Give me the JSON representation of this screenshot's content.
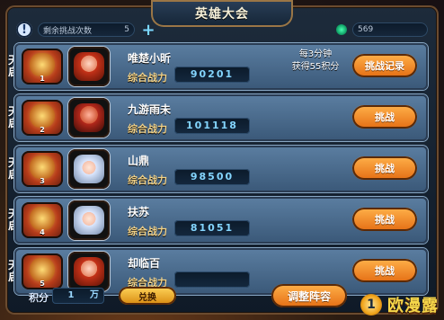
{
  "window": {
    "title": "英雄大会"
  },
  "topbar": {
    "remaining_label": "剩余挑战次数",
    "remaining_value": "5",
    "plus_symbol": "+",
    "coins_value": "569"
  },
  "rows": [
    {
      "rank_tab": [
        "天",
        "启"
      ],
      "badge_rank": "1",
      "name": "唯楚小昕",
      "power_label": "综合战力",
      "power_value": "90201",
      "reward_line1": "每3分钟",
      "reward_line2": "获得55积分",
      "button_label": "挑战记录",
      "avatar_icon": "hero-red-hair-icon",
      "avatar_color": "#c63218"
    },
    {
      "rank_tab": [
        "天",
        "启"
      ],
      "badge_rank": "2",
      "name": "九游雨未",
      "power_label": "综合战力",
      "power_value": "101118",
      "button_label": "挑战",
      "avatar_icon": "hero-red-mask-icon",
      "avatar_color": "#b4281b"
    },
    {
      "rank_tab": [
        "天",
        "启"
      ],
      "badge_rank": "3",
      "name": "山鼎",
      "power_label": "综合战力",
      "power_value": "98500",
      "button_label": "挑战",
      "avatar_icon": "hero-white-hair-icon",
      "avatar_color": "#8fa7c6"
    },
    {
      "rank_tab": [
        "天",
        "启"
      ],
      "badge_rank": "4",
      "name": "扶苏",
      "power_label": "综合战力",
      "power_value": "81051",
      "button_label": "挑战",
      "avatar_icon": "hero-white-hair-icon",
      "avatar_color": "#8fa7c6"
    },
    {
      "rank_tab": [
        "天",
        "启"
      ],
      "badge_rank": "5",
      "name": "却临百",
      "power_label": "综合战力",
      "power_value": "",
      "button_label": "挑战",
      "avatar_icon": "hero-red-hair-icon",
      "avatar_color": "#c63218"
    }
  ],
  "bottombar": {
    "score_label": "积分",
    "score_value": "1",
    "score_unit": "万",
    "exchange_label": "兑换",
    "adjust_label": "调整阵容"
  },
  "watermark": {
    "logo_text": "1",
    "text": "欧漫露"
  }
}
